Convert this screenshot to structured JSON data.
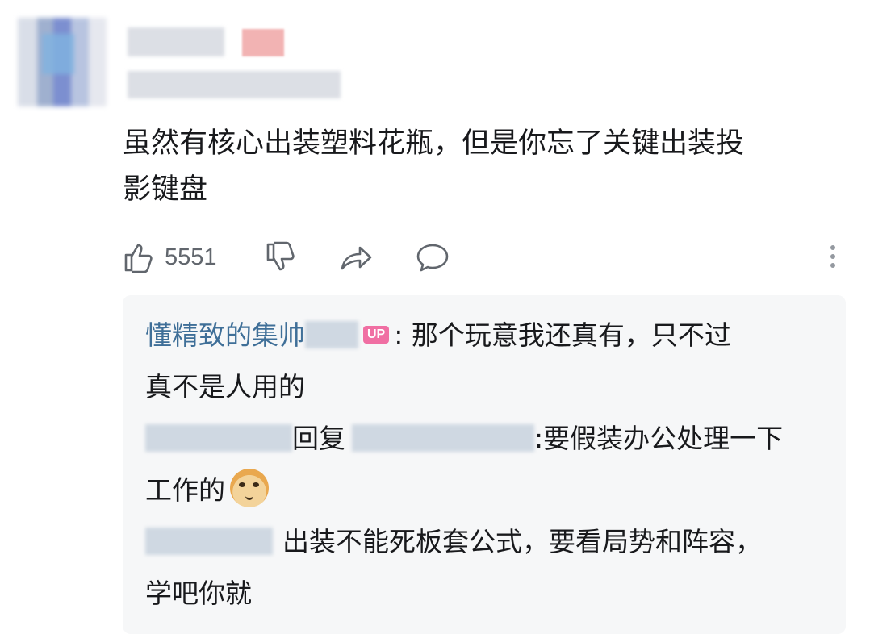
{
  "comment": {
    "text_line1": "虽然有核心出装塑料花瓶，但是你忘了关键出装投",
    "text_line2": "影键盘"
  },
  "actions": {
    "like_count": "5551",
    "icons": [
      "thumb-up-icon",
      "thumb-down-icon",
      "share-icon",
      "reply-icon",
      "more-icon"
    ]
  },
  "replies": [
    {
      "user": "懂精致的集帅",
      "badge": "UP",
      "text_line1": ": 那个玩意我还真有，只不过",
      "text_line2": "真不是人用的"
    },
    {
      "reply_word": "回复",
      "text_line1": ":要假装办公处理一下",
      "text_line2": "工作的"
    },
    {
      "text_line1": "出装不能死板套公式，要看局势和阵容，",
      "text_line2": "学吧你就"
    }
  ],
  "colors": {
    "username": "#3f6f98",
    "up_badge": "#f06fa3",
    "reply_bg": "#f6f7f8",
    "icon_gray": "#61666d"
  }
}
